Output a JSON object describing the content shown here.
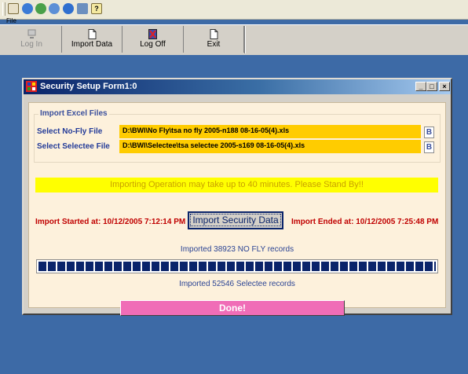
{
  "quickbar": {
    "menu_label": "File",
    "icons": [
      "open-icon",
      "help-agent-icon",
      "contacts-icon",
      "add-icon",
      "ie-icon",
      "calculator-icon",
      "help-icon"
    ]
  },
  "toolbar": {
    "buttons": [
      {
        "label": "Log In",
        "icon": "computer-icon",
        "enabled": false
      },
      {
        "label": "Import Data",
        "icon": "document-icon",
        "enabled": true
      },
      {
        "label": "Log Off",
        "icon": "logoff-icon",
        "enabled": true
      },
      {
        "label": "Exit",
        "icon": "document-icon",
        "enabled": true
      }
    ]
  },
  "window": {
    "title": "Security Setup Form1:0",
    "controls": {
      "minimize": "_",
      "maximize": "□",
      "close": "×"
    }
  },
  "import_group": {
    "legend": "Import Excel Files",
    "no_fly": {
      "label": "Select No-Fly File",
      "value": "D:\\BWI\\No Fly\\tsa no fly 2005-n188 08-16-05(4).xls",
      "browse": "B"
    },
    "selectee": {
      "label": "Select Selectee File",
      "value": "D:\\BWI\\Selectee\\tsa selectee 2005-s169 08-16-05(4).xls",
      "browse": "B"
    }
  },
  "banner": "Importing Operation may take up to 40 minutes. Please Stand By!!",
  "import": {
    "started": "Import Started at: 10/12/2005 7:12:14 PM",
    "button": "Import Security Data",
    "ended": "Import Ended at: 10/12/2005 7:25:48 PM"
  },
  "status": {
    "no_fly": "Imported 38923 NO FLY records",
    "selectee": "Imported 52546 Selectee records",
    "progress_percent": 100
  },
  "done_button": "Done!",
  "colors": {
    "accent": "#0a246a",
    "field": "#ffcc00",
    "banner": "#ffff00",
    "done": "#f06db7",
    "error_text": "#c00000"
  }
}
